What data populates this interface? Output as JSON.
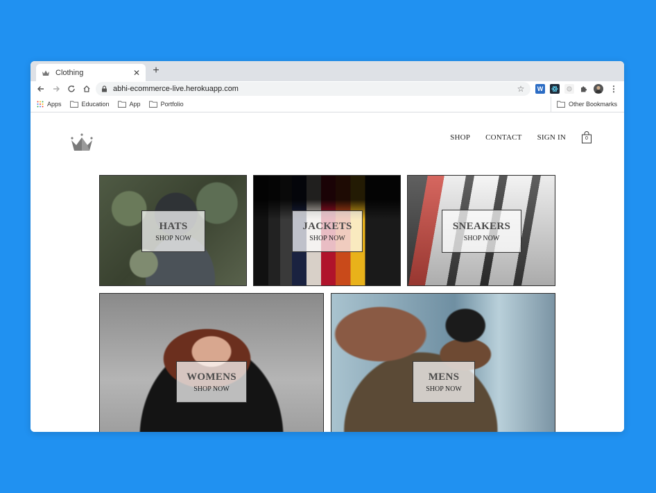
{
  "browser": {
    "tab_title": "Clothing",
    "url": "abhi-ecommerce-live.herokuapp.com",
    "bookmarks": [
      "Apps",
      "Education",
      "App",
      "Portfolio"
    ],
    "other_bookmarks": "Other Bookmarks"
  },
  "site": {
    "nav": [
      "SHOP",
      "CONTACT",
      "SIGN IN"
    ],
    "cart_count": "0"
  },
  "categories": [
    {
      "title": "HATS",
      "cta": "SHOP NOW"
    },
    {
      "title": "JACKETS",
      "cta": "SHOP NOW"
    },
    {
      "title": "SNEAKERS",
      "cta": "SHOP NOW"
    },
    {
      "title": "WOMENS",
      "cta": "SHOP NOW"
    },
    {
      "title": "MENS",
      "cta": "SHOP NOW"
    }
  ],
  "colors": {
    "background": "#2091f1"
  }
}
